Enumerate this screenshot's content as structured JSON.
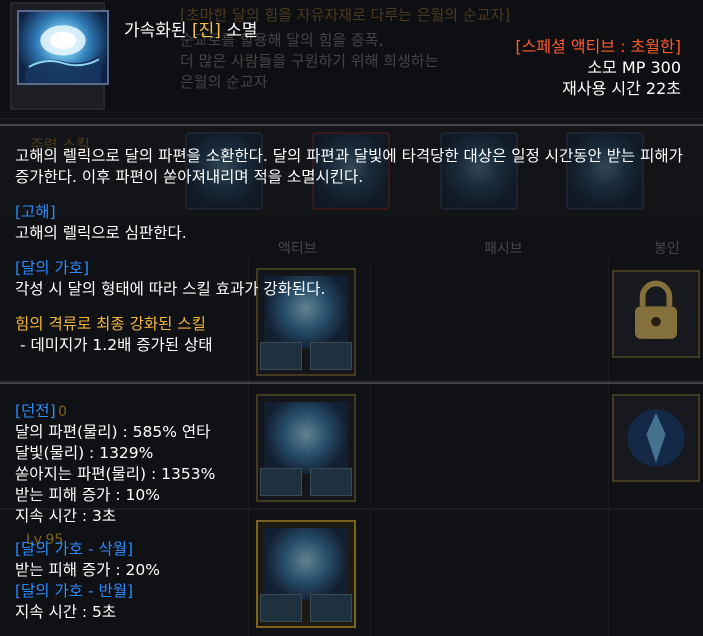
{
  "background": {
    "header_title": "[초마한 달의 힘을 자유자재로 다루는 은월의 순교자]",
    "header_desc": "순교로를 할용해 달의 힘을 증폭,\n더 많은 사람들을 구원하기 위해 희생하는\n은월의 순교자",
    "tab_label": "주력 스킬",
    "col_active": "액티브",
    "col_passive": "패시브",
    "col_seal": "봉인",
    "lv_badge_1": "0",
    "lv_badge_2": "Lv.95"
  },
  "tooltip": {
    "name_prefix": "가속화된 ",
    "name_tag": "[진]",
    "name_suffix": " 소멸",
    "type": "[스페셜 액티브 : 초월한]",
    "mp": "소모 MP 300",
    "cooldown": "재사용 시간 22초",
    "description": "고해의 렐릭으로 달의 파편을 소환한다. 달의 파편과 달빛에 타격당한 대상은 일정 시간동안 받는 피해가 증가한다. 이후 파편이 쏟아져내리며 적을 소멸시킨다.",
    "section_gohae_title": "[고해]",
    "section_gohae_text": "고해의 렐릭으로 심판한다.",
    "section_blessing_title": "[달의 가호]",
    "section_blessing_text": "각성 시 달의 형태에 따라 스킬 효과가 강화된다.",
    "enhanced_title": "힘의 격류로 최종 강화된 스킬",
    "enhanced_text": " - 데미지가 1.2배 증가된 상태",
    "dungeon_title": "[던전]",
    "dungeon_stats": [
      "달의 파편(물리) : 585% 연타",
      "달빛(물리) : 1329%",
      "쏟아지는 파편(물리) : 1353%",
      "받는 피해 증가 : 10%",
      "지속 시간 : 3초"
    ],
    "crescent_title": "[달의 가호 - 삭월]",
    "crescent_text": "받는 피해 증가 : 20%",
    "half_title": "[달의 가호 - 반월]",
    "half_text": "지속 시간 : 5초"
  },
  "colors": {
    "section_blue": "#2b8cff",
    "gold": "#f6b73c",
    "type_orange": "#ff5a2a"
  }
}
